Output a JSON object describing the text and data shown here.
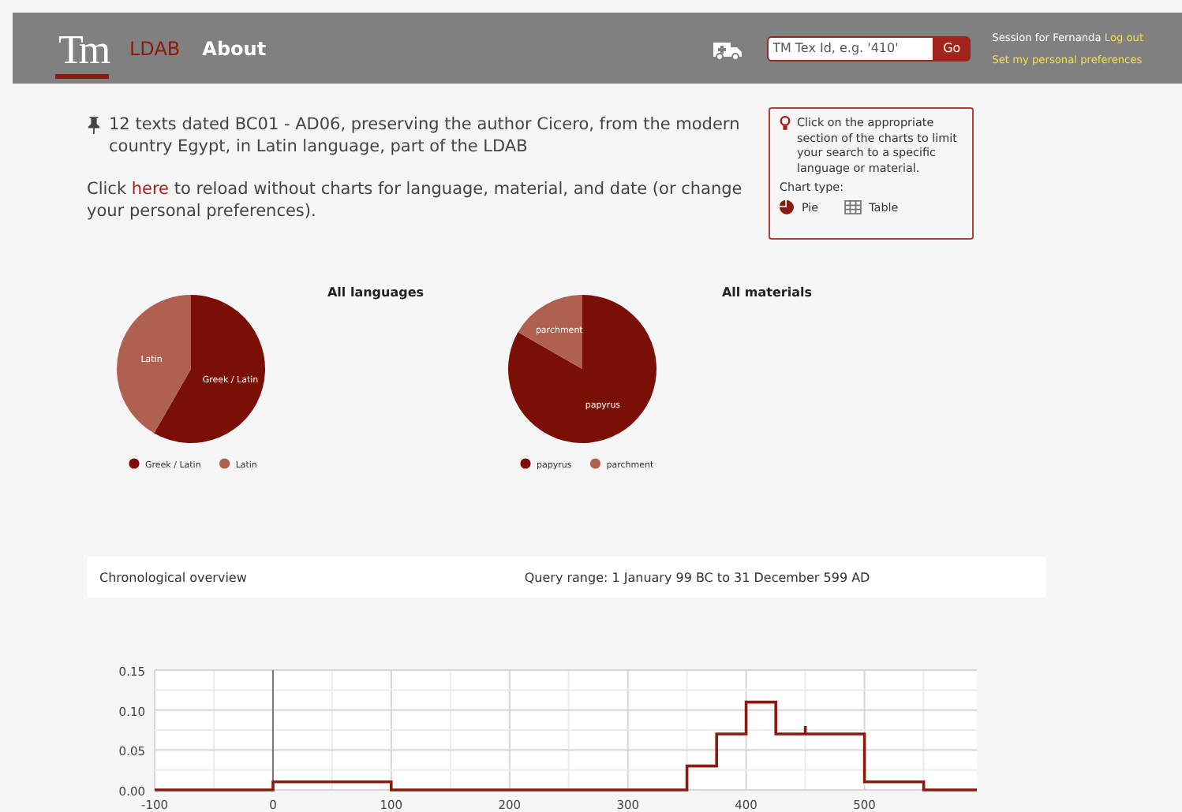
{
  "header": {
    "logo": "Tm",
    "nav": [
      {
        "label": "LDAB",
        "selected": true
      },
      {
        "label": "About",
        "selected": false
      }
    ],
    "search": {
      "placeholder": "TM Tex Id, e.g. '410'",
      "button": "Go"
    },
    "session": {
      "text": "Session for Fernanda",
      "logout": "Log out",
      "preferences": "Set my personal preferences"
    }
  },
  "summary": {
    "text": "12 texts dated BC01 - AD06, preserving the author Cicero, from the modern country Egypt, in Latin language, part of the LDAB",
    "reload": {
      "before": "Click ",
      "link": "here",
      "after": " to reload without charts for language, material, and date (or change your personal preferences)."
    }
  },
  "hint_box": {
    "text": "Click on the appropriate section of the charts to limit your search to a specific language or material.",
    "chart_type_label": "Chart type:",
    "options": [
      {
        "label": "Pie",
        "kind": "pie",
        "selected": true
      },
      {
        "label": "Table",
        "kind": "table",
        "selected": false
      }
    ]
  },
  "pies": [
    {
      "chart_data": {
        "type": "pie",
        "title": "All languages",
        "categories": [
          "Greek / Latin",
          "Latin"
        ],
        "series": [
          {
            "values": [
              58.3,
              41.7
            ]
          }
        ],
        "colors": [
          "#7a0f05",
          "#b0604e"
        ],
        "legend": "bottom"
      }
    },
    {
      "chart_data": {
        "type": "pie",
        "title": "All materials",
        "categories": [
          "papyrus",
          "parchment"
        ],
        "series": [
          {
            "values": [
              83.3,
              16.7
            ]
          }
        ],
        "colors": [
          "#7a0f05",
          "#b0604e"
        ],
        "legend": "bottom"
      }
    }
  ],
  "chronology": {
    "title": "Chronological overview",
    "range": "Query range: 1 January 99 BC to 31 December 599 AD",
    "chart_data": {
      "type": "line",
      "x": [
        -100,
        0,
        0,
        100,
        100,
        350,
        350,
        375,
        375,
        400,
        400,
        425,
        425,
        450,
        450,
        450,
        500,
        500,
        550,
        550,
        595
      ],
      "grid": true,
      "series": [
        {
          "color": "#8b1a10",
          "values": [
            0,
            0,
            0.01,
            0.01,
            0,
            0,
            0.03,
            0.03,
            0.07,
            0.07,
            0.11,
            0.11,
            0.07,
            0.07,
            0.08,
            0.07,
            0.07,
            0.01,
            0.01,
            0,
            0
          ]
        }
      ],
      "xlim": [
        -100,
        595
      ],
      "ylim": [
        0,
        0.15
      ],
      "xticks": [
        -100,
        0,
        100,
        200,
        300,
        400,
        500
      ],
      "yticks": [
        {
          "value": 0,
          "label": "0.00"
        },
        {
          "value": 0.05,
          "label": "0.05"
        },
        {
          "value": 0.1,
          "label": "0.10"
        },
        {
          "value": 0.15,
          "label": "0.15"
        }
      ]
    }
  }
}
